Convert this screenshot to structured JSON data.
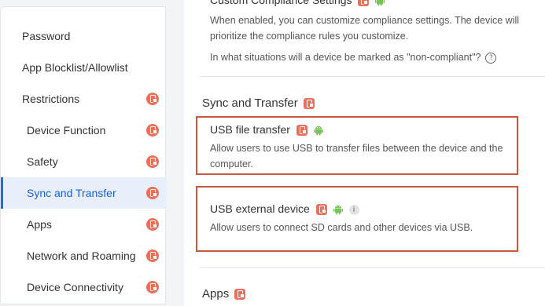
{
  "sidebar": {
    "items": [
      {
        "label": "Password",
        "level": 1,
        "badge": false,
        "active": false
      },
      {
        "label": "App Blocklist/Allowlist",
        "level": 1,
        "badge": false,
        "active": false
      },
      {
        "label": "Restrictions",
        "level": 1,
        "badge": true,
        "active": false
      },
      {
        "label": "Device Function",
        "level": 2,
        "badge": true,
        "active": false
      },
      {
        "label": "Safety",
        "level": 2,
        "badge": true,
        "active": false
      },
      {
        "label": "Sync and Transfer",
        "level": 2,
        "badge": true,
        "active": true
      },
      {
        "label": "Apps",
        "level": 2,
        "badge": true,
        "active": false
      },
      {
        "label": "Network and Roaming",
        "level": 2,
        "badge": true,
        "active": false
      },
      {
        "label": "Device Connectivity",
        "level": 2,
        "badge": true,
        "active": false
      }
    ]
  },
  "main": {
    "compliance": {
      "title": "Custom Compliance Settings",
      "description": "When enabled, you can customize compliance settings. The device will prioritize the compliance rules you customize.",
      "question": "In what situations will a device be marked as \"non-compliant\"?"
    },
    "sync_section": {
      "title": "Sync and Transfer",
      "usb_file_transfer": {
        "title": "USB file transfer",
        "description": "Allow users to use USB to transfer files between the device and the computer."
      },
      "usb_external_device": {
        "title": "USB external device",
        "description": "Allow users to connect SD cards and other devices via USB."
      }
    },
    "apps_section": {
      "title": "Apps"
    }
  },
  "icons": {
    "badge": "phone-badge-icon",
    "android": "android-icon",
    "info": "info-icon",
    "help": "help-icon"
  },
  "colors": {
    "badge": "#e8705c",
    "android": "#78c257",
    "active_bg": "#e8effb",
    "active_text": "#1a5fd6",
    "highlight_border": "#c9583f"
  }
}
